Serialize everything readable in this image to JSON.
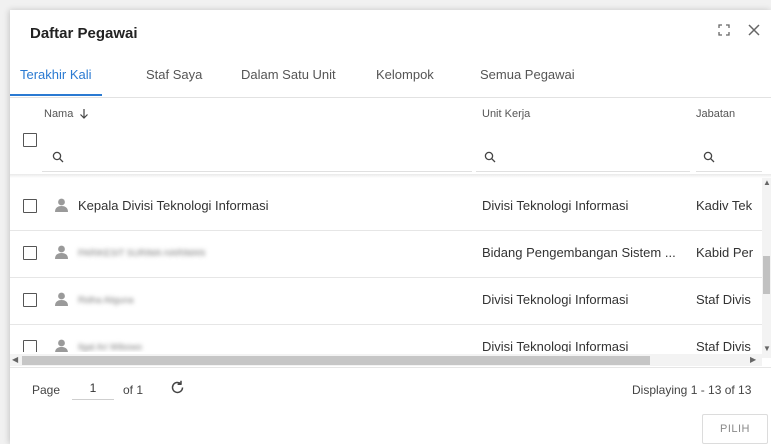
{
  "dialog": {
    "title": "Daftar Pegawai"
  },
  "tabs": [
    {
      "label": "Terakhir Kali",
      "active": true
    },
    {
      "label": "Staf Saya",
      "active": false
    },
    {
      "label": "Dalam Satu Unit",
      "active": false
    },
    {
      "label": "Kelompok",
      "active": false
    },
    {
      "label": "Semua Pegawai",
      "active": false
    }
  ],
  "columns": {
    "nama": "Nama",
    "unit": "Unit Kerja",
    "jabatan": "Jabatan",
    "sort_icon": "arrow-down-icon"
  },
  "rows": [
    {
      "nama": "Kepala Divisi Teknologi Informasi",
      "unit": "Divisi Teknologi Informasi",
      "jabatan": "Kadiv Tek",
      "blurred": false
    },
    {
      "nama": "PARIKESIT SURIMA HARIMAN",
      "unit": "Bidang Pengembangan Sistem ...",
      "jabatan": "Kabid Per",
      "blurred": true
    },
    {
      "nama": "Ridha Aliguna",
      "unit": "Divisi Teknologi Informasi",
      "jabatan": "Staf Divis",
      "blurred": true
    },
    {
      "nama": "Ilgal Ari Wibowo",
      "unit": "Divisi Teknologi Informasi",
      "jabatan": "Staf Divis",
      "blurred": true
    }
  ],
  "paging": {
    "page_label": "Page",
    "page_value": "1",
    "of_label": "of 1",
    "displaying": "Displaying 1 - 13 of 13"
  },
  "actions": {
    "select_label": "PILIH"
  },
  "colors": {
    "accent": "#2a7ad2",
    "text": "#333333"
  }
}
